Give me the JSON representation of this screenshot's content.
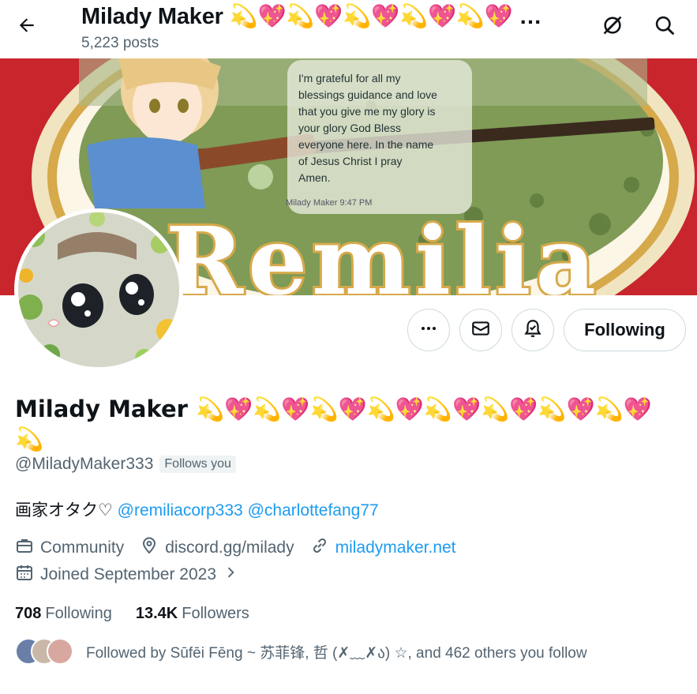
{
  "header": {
    "back_icon": "arrow-left-icon",
    "title": "Milady Maker 💫💖💫💖💫💖💫💖💫💖 …",
    "posts_count": "5,223 posts",
    "right_icons": [
      "grok-icon",
      "search-icon"
    ]
  },
  "banner": {
    "brand_text": "Remilia",
    "message_lines": [
      "I'm grateful for all my",
      "blessings guidance and love",
      "that you give me  my glory is",
      "your glory God Bless",
      "everyone here.  In the name",
      "of Jesus Christ  I pray",
      "Amen."
    ],
    "message_meta": "Milady Maker  9:47 PM"
  },
  "actions": {
    "more_icon": "more-icon",
    "message_icon": "envelope-icon",
    "notify_icon": "bell-check-icon",
    "following_label": "Following"
  },
  "profile": {
    "name": "Milady Maker 💫💖💫💖💫💖💫💖💫💖💫💖💫💖💫💖💫",
    "handle": "@MiladyMaker333",
    "follows_you": "Follows you",
    "bio_text": "画家オタク♡ ",
    "bio_mentions": [
      "@remiliacorp333",
      "@charlottefang77"
    ],
    "category": "Community",
    "location": "discord.gg/milady",
    "website": "miladymaker.net",
    "joined": "Joined September 2023"
  },
  "stats": {
    "following_count": "708",
    "following_label": "Following",
    "followers_count": "13.4K",
    "followers_label": "Followers"
  },
  "followed_by": {
    "text": "Followed by Sūfēi Fēng ~ 苏菲锋, 哲 (✗﹏✗ა) ☆, and 462 others you follow"
  },
  "colors": {
    "accent": "#1d9bf0",
    "banner_red": "#c8252d",
    "muted_text": "#536471",
    "border": "#cfd9de"
  }
}
